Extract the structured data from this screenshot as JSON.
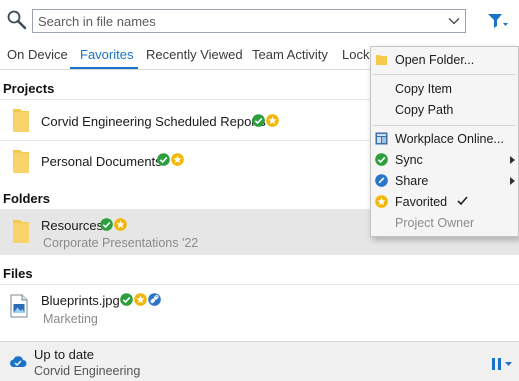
{
  "search": {
    "placeholder": "Search in file names"
  },
  "tabs": [
    {
      "label": "On Device"
    },
    {
      "label": "Favorites",
      "active": true
    },
    {
      "label": "Recently Viewed"
    },
    {
      "label": "Team Activity"
    },
    {
      "label": "Locked"
    }
  ],
  "sections": {
    "projects": {
      "title": "Projects",
      "items": [
        {
          "name": "Corvid Engineering Scheduled Reports",
          "badges": [
            "synced-check-icon",
            "favorite-star-icon"
          ]
        },
        {
          "name": "Personal Documents",
          "badges": [
            "synced-check-icon",
            "favorite-star-icon"
          ]
        }
      ]
    },
    "folders": {
      "title": "Folders",
      "items": [
        {
          "name": "Resources",
          "subtitle": "Corporate Presentations '22",
          "badges": [
            "synced-check-icon",
            "favorite-star-icon"
          ],
          "selected": true
        }
      ]
    },
    "files": {
      "title": "Files",
      "items": [
        {
          "name": "Blueprints.jpg",
          "subtitle": "Marketing",
          "badges": [
            "synced-check-icon",
            "favorite-star-icon",
            "shared-link-icon"
          ]
        }
      ]
    }
  },
  "status": {
    "title": "Up to date",
    "subtitle": "Corvid Engineering"
  },
  "context_menu": {
    "items": [
      {
        "label": "Open Folder...",
        "icon": "folder-icon"
      },
      {
        "label": "Copy Item"
      },
      {
        "label": "Copy Path"
      },
      {
        "label": "Workplace Online...",
        "icon": "workplace-online-icon"
      },
      {
        "label": "Sync",
        "icon": "sync-check-icon",
        "submenu": true
      },
      {
        "label": "Share",
        "icon": "share-link-icon",
        "submenu": true
      },
      {
        "label": "Favorited",
        "icon": "favorite-star-icon",
        "checked": true
      },
      {
        "label": "Project Owner",
        "disabled": true
      }
    ]
  },
  "colors": {
    "accent": "#1a73c7",
    "folder": "#f5c94c",
    "sync_green": "#2e9e3e",
    "star_yellow": "#f2b705",
    "selected_row": "#e6e6e6"
  }
}
